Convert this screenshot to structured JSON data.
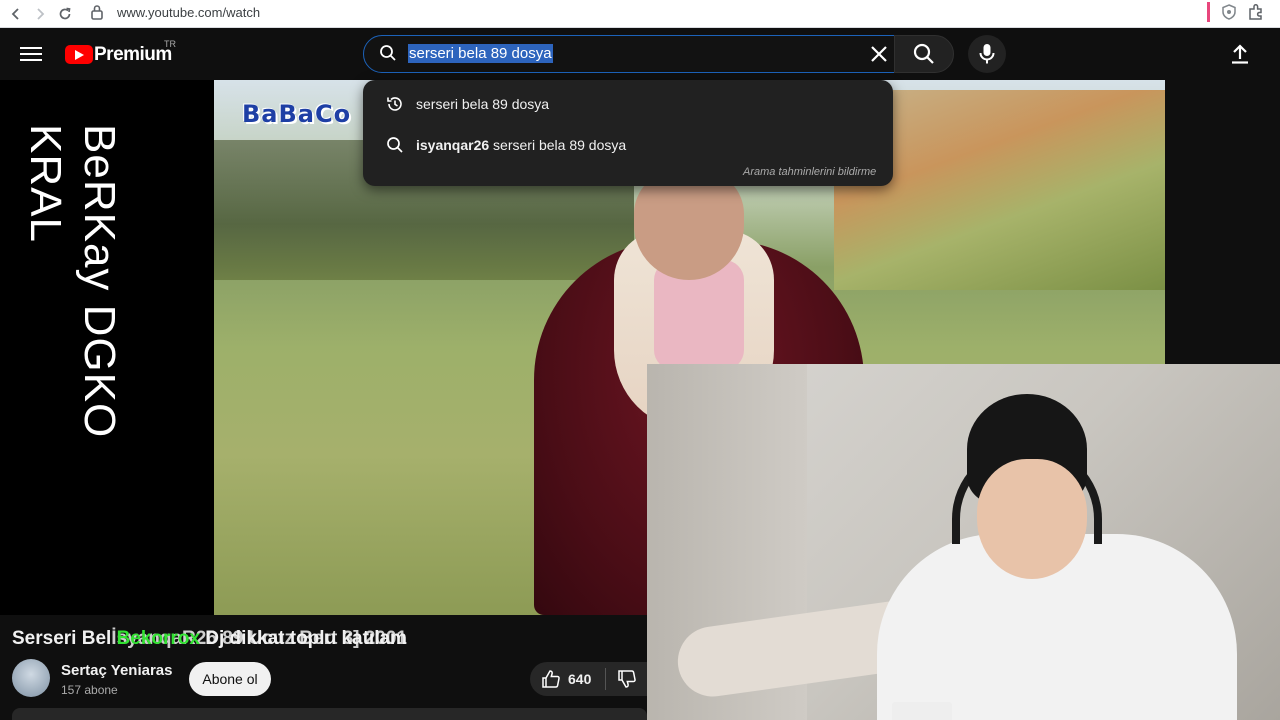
{
  "browser": {
    "url": "www.youtube.com/watch",
    "icons": [
      "back-icon",
      "forward-icon",
      "reload-icon",
      "lock-icon",
      "shield-icon",
      "extensions-icon"
    ]
  },
  "header": {
    "logo_text": "Premium",
    "logo_country": "TR",
    "search_value": "serseri bela 89 dosya",
    "icons": [
      "menu-icon",
      "search-icon",
      "clear-icon",
      "mic-icon",
      "upload-icon"
    ]
  },
  "dropdown": {
    "suggestions": [
      {
        "icon": "history-icon",
        "text": "serseri bela 89 dosya",
        "bold": ""
      },
      {
        "icon": "search-icon",
        "text": " serseri bela 89 dosya",
        "bold": "isyanqar26"
      }
    ],
    "report_label": "Arama tahminlerini bildirme"
  },
  "stream": {
    "side_label": "BeRKay DGKO KRAL",
    "video_watermark": "BaBaCo",
    "overlay_line": {
      "title_part": "Serseri Bel",
      "username": "Bekorrox",
      "ghost_text": "İsyanqaR26 89 Ucuz Bert 3] 2001",
      "message": "Dj dikkat toplu katılam"
    }
  },
  "video_info": {
    "channel_name": "Sertaç Yeniaras",
    "subscribers": "157 abone",
    "subscribe_label": "Abone ol",
    "like_count": "640",
    "icons": [
      "like-icon",
      "dislike-icon"
    ]
  },
  "colors": {
    "yt_red": "#ff0000",
    "selection": "#2d64bd",
    "chat_green": "#33e233",
    "background": "#0f0f0f"
  }
}
